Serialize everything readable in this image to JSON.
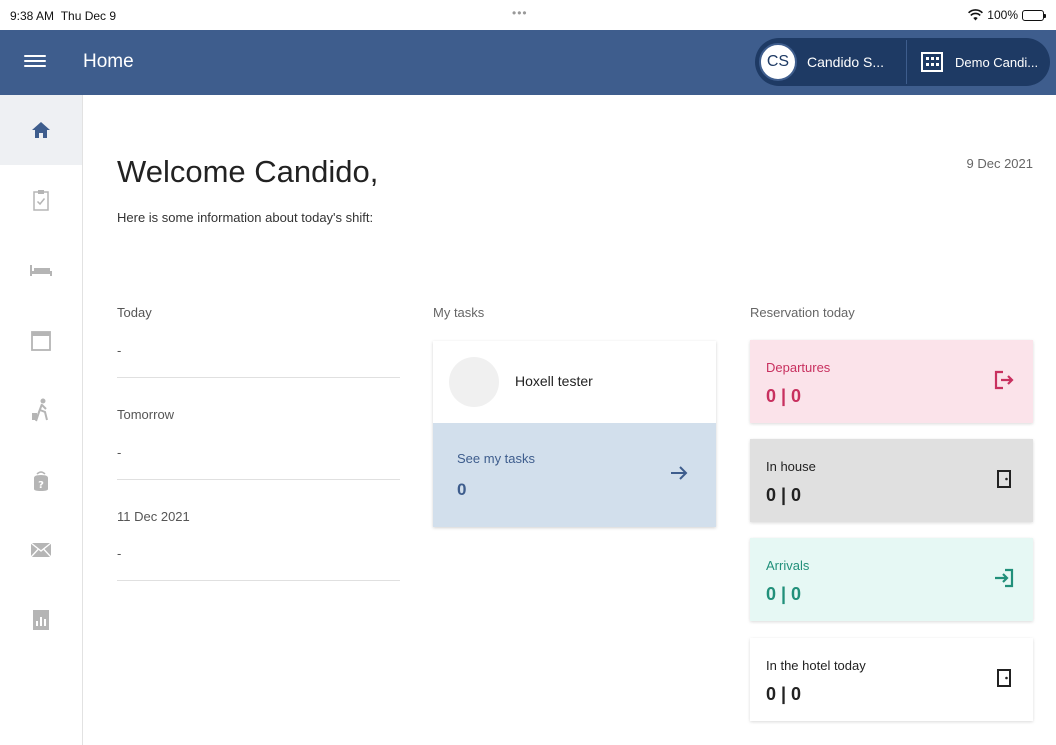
{
  "status_bar": {
    "time": "9:38 AM",
    "day": "Thu Dec 9",
    "dots": "•••",
    "battery": "100%",
    "battery_level": 1.0
  },
  "app_bar": {
    "title": "Home",
    "user_initials": "CS",
    "user_name": "Candido S...",
    "hotel_name": "Demo Candi..."
  },
  "sidebar": {
    "items": [
      {
        "name": "home",
        "icon": "home-icon",
        "active": true
      },
      {
        "name": "tasks",
        "icon": "clipboard-check-icon",
        "active": false
      },
      {
        "name": "rooms",
        "icon": "bed-icon",
        "active": false
      },
      {
        "name": "calendar",
        "icon": "calendar-icon",
        "active": false
      },
      {
        "name": "guests",
        "icon": "person-luggage-icon",
        "active": false
      },
      {
        "name": "lost-found",
        "icon": "bag-question-icon",
        "active": false
      },
      {
        "name": "messages",
        "icon": "mail-icon",
        "active": false
      },
      {
        "name": "reports",
        "icon": "report-icon",
        "active": false
      }
    ]
  },
  "main": {
    "welcome": "Welcome Candido,",
    "subtitle": "Here is some information about today's shift:",
    "date": "9 Dec 2021",
    "shifts": {
      "label": "Today",
      "items": [
        {
          "title": "Today",
          "value": "-"
        },
        {
          "title": "Tomorrow",
          "value": "-"
        },
        {
          "title": "11 Dec 2021",
          "value": "-"
        }
      ]
    },
    "tasks": {
      "label": "My tasks",
      "assignee": "Hoxell tester",
      "see_label": "See my tasks",
      "count": "0"
    },
    "reservations": {
      "label": "Reservation today",
      "items": [
        {
          "title": "Departures",
          "value": "0 | 0",
          "icon": "door-exit-icon",
          "bg": "#fbe3ea",
          "color": "#c8305f"
        },
        {
          "title": "In house",
          "value": "0 | 0",
          "icon": "door-icon",
          "bg": "#e0e0e0",
          "color": "#222222"
        },
        {
          "title": "Arrivals",
          "value": "0 | 0",
          "icon": "door-enter-icon",
          "bg": "#e6f8f4",
          "color": "#21907a"
        },
        {
          "title": "In the hotel today",
          "value": "0 | 0",
          "icon": "door-icon",
          "bg": "#ffffff",
          "color": "#222222"
        }
      ]
    }
  }
}
